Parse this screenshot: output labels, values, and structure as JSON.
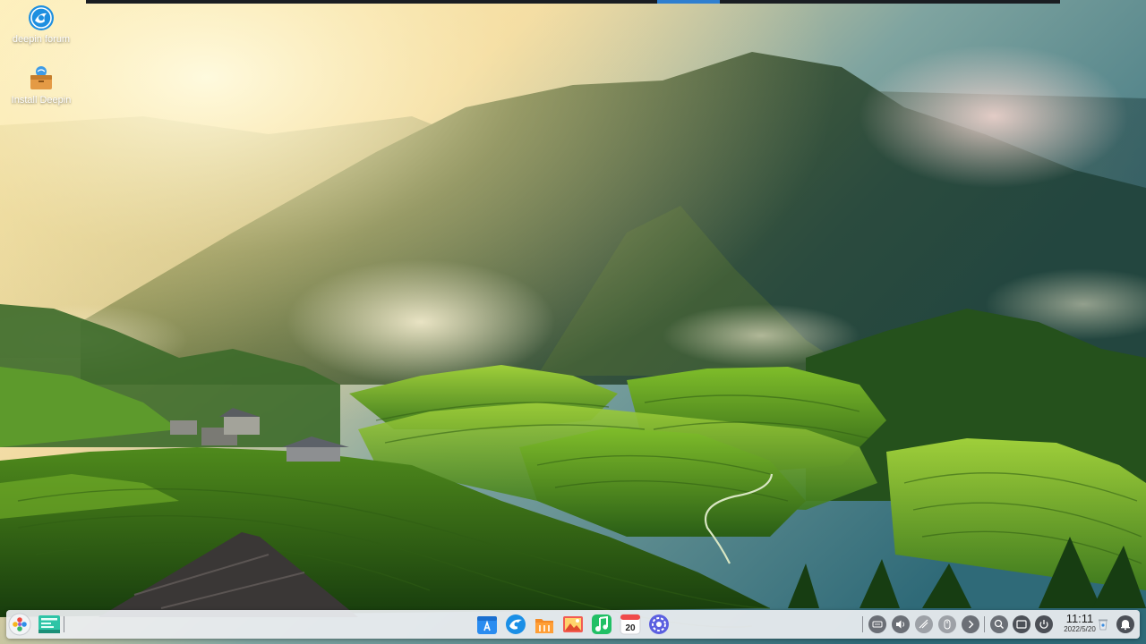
{
  "desktop": {
    "icons": [
      {
        "label": "deepin forum",
        "icon": "deepin-forum-icon"
      },
      {
        "label": "Install Deepin",
        "icon": "install-deepin-icon"
      }
    ]
  },
  "dock": {
    "left": [
      {
        "name": "launcher-icon"
      },
      {
        "name": "multitasking-view-icon"
      }
    ],
    "apps": [
      {
        "name": "app-store-icon"
      },
      {
        "name": "browser-icon"
      },
      {
        "name": "file-manager-icon"
      },
      {
        "name": "image-viewer-icon"
      },
      {
        "name": "music-icon"
      },
      {
        "name": "calendar-icon",
        "day": "20"
      },
      {
        "name": "control-center-icon"
      }
    ],
    "tray": [
      {
        "name": "keyboard-icon"
      },
      {
        "name": "volume-icon"
      },
      {
        "name": "network-icon"
      },
      {
        "name": "mouse-icon"
      },
      {
        "name": "expand-tray-icon"
      },
      {
        "name": "search-icon"
      },
      {
        "name": "show-desktop-icon"
      },
      {
        "name": "power-icon"
      },
      {
        "name": "trash-icon"
      },
      {
        "name": "notification-icon"
      }
    ],
    "clock": {
      "time": "11:11",
      "date": "2022/5/20"
    }
  }
}
